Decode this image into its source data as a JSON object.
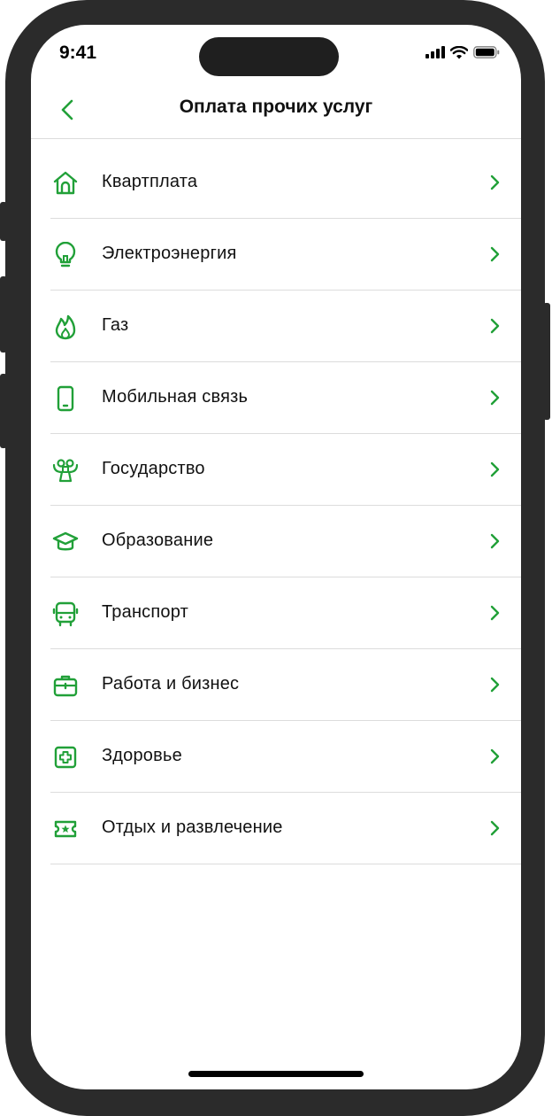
{
  "status_bar": {
    "time": "9:41"
  },
  "header": {
    "title": "Оплата прочих услуг"
  },
  "colors": {
    "accent": "#21a038",
    "text": "#111111",
    "divider": "#dcdcdc"
  },
  "services": [
    {
      "label": "Квартплата",
      "icon": "house-icon"
    },
    {
      "label": "Электроэнергия",
      "icon": "lightbulb-icon"
    },
    {
      "label": "Газ",
      "icon": "flame-icon"
    },
    {
      "label": "Мобильная связь",
      "icon": "smartphone-icon"
    },
    {
      "label": "Государство",
      "icon": "eagle-emblem-icon"
    },
    {
      "label": "Образование",
      "icon": "graduation-cap-icon"
    },
    {
      "label": "Транспорт",
      "icon": "bus-icon"
    },
    {
      "label": "Работа и бизнес",
      "icon": "briefcase-icon"
    },
    {
      "label": "Здоровье",
      "icon": "medical-cross-icon"
    },
    {
      "label": "Отдых и развлечение",
      "icon": "ticket-icon"
    }
  ]
}
